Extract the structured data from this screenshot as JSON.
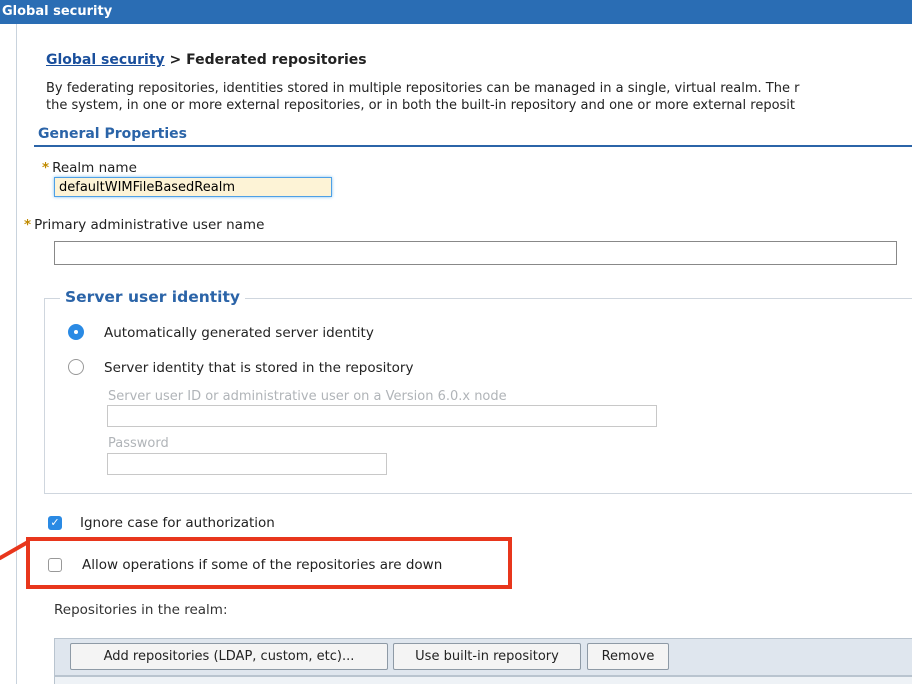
{
  "window": {
    "title": "Global security"
  },
  "breadcrumb": {
    "link": "Global security",
    "separator": " > ",
    "current": "Federated repositories"
  },
  "description": {
    "line1": "By federating repositories, identities stored in multiple repositories can be managed in a single, virtual realm. The r",
    "line2": "the system, in one or more external repositories, or in both the built-in repository and one or more external reposit"
  },
  "general_properties": {
    "title": "General Properties",
    "required_marker": "*",
    "realm_name": {
      "label": "Realm name",
      "value": "defaultWIMFileBasedRealm"
    },
    "primary_admin": {
      "label": "Primary administrative user name",
      "value": ""
    }
  },
  "server_identity": {
    "legend": "Server user identity",
    "options": [
      {
        "label": "Automatically generated server identity",
        "selected": true
      },
      {
        "label": "Server identity that is stored in the repository",
        "selected": false
      }
    ],
    "server_user_id": {
      "label": "Server user ID or administrative user on a Version 6.0.x node",
      "value": ""
    },
    "password": {
      "label": "Password",
      "value": ""
    }
  },
  "options": {
    "ignore_case": {
      "label": "Ignore case for authorization",
      "checked": true
    },
    "allow_operations": {
      "label": "Allow operations if some of the repositories are down",
      "checked": false
    }
  },
  "repositories": {
    "label": "Repositories in the realm:",
    "buttons": {
      "add": "Add repositories (LDAP, custom, etc)...",
      "builtin": "Use built-in repository",
      "remove": "Remove"
    }
  },
  "colors": {
    "title_bar": "#2a6db4",
    "link": "#1a4f9c",
    "section_heading": "#2b64a8",
    "accent": "#2a8ae4",
    "highlight_border": "#e8361c",
    "realm_field_bg": "#fdf3d6"
  },
  "icons": {
    "checkbox_checked": "check-icon",
    "arrow": "red-arrow-annotation"
  }
}
